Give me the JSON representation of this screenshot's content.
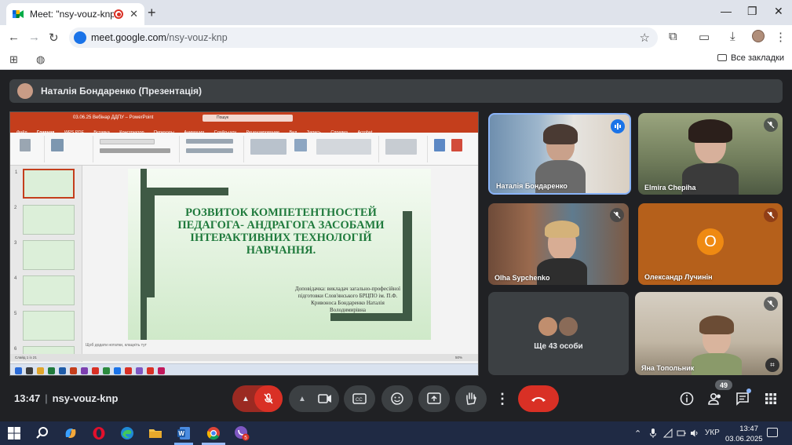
{
  "browser": {
    "tab_title": "Meet: \"nsy-vouz-knp\"",
    "url_domain": "meet.google.com",
    "url_path": "/nsy-vouz-knp",
    "bookmarks_label": "Все закладки"
  },
  "meet": {
    "presenter_label": "Наталія Бондаренко (Презентація)",
    "meeting_time": "13:47",
    "meeting_code": "nsy-vouz-knp",
    "people_count": "49",
    "others_label": "Ще 43 особи"
  },
  "participants": [
    {
      "name": "Наталія Бондаренко"
    },
    {
      "name": "Elmira Chepiha"
    },
    {
      "name": "Olha Sypchenko"
    },
    {
      "name": "Олександр Лучинін",
      "initial": "О",
      "color": "#ef8a12"
    },
    {
      "name": "Яна Топольник"
    }
  ],
  "presentation": {
    "window_title": "03.06.25 Вебінар ДДПУ – PowerPoint",
    "search_placeholder": "Пошук",
    "ribbon_tabs": [
      "Файл",
      "Главная",
      "WPS PDF",
      "Вставка",
      "Конструктор",
      "Переходы",
      "Анимация",
      "Слайд-шоу",
      "Рецензирование",
      "Вид",
      "Запись",
      "Справка",
      "Acrobat"
    ],
    "slide_numbers": [
      "1",
      "2",
      "3",
      "4",
      "5",
      "6"
    ],
    "slide_title": "РОЗВИТОК КОМПЕТЕНТНОСТЕЙ ПЕДАГОГА- АНДРАГОГА ЗАСОБАМИ ІНТЕРАКТИВНИХ ТЕХНОЛОГІЙ НАВЧАННЯ.",
    "slide_author": "Доповідачка: викладач загально-професійної підготовки Слов'янського БРЦПО ім. П.Ф. Кривоноса Бондаренко Наталія Володимирівна",
    "notes_placeholder": "Щоб додати нотатки, клацніть тут",
    "status_text": "Слайд 1 із 21",
    "zoom": "50%"
  },
  "taskbar": {
    "language": "УКР",
    "time": "13:47",
    "date": "03.06.2025",
    "viber_badge": "5"
  },
  "colors": {
    "meet_bg": "#202124",
    "end_call": "#d93025",
    "ppt_accent": "#c43e1c",
    "slide_title": "#1f7a3c"
  }
}
